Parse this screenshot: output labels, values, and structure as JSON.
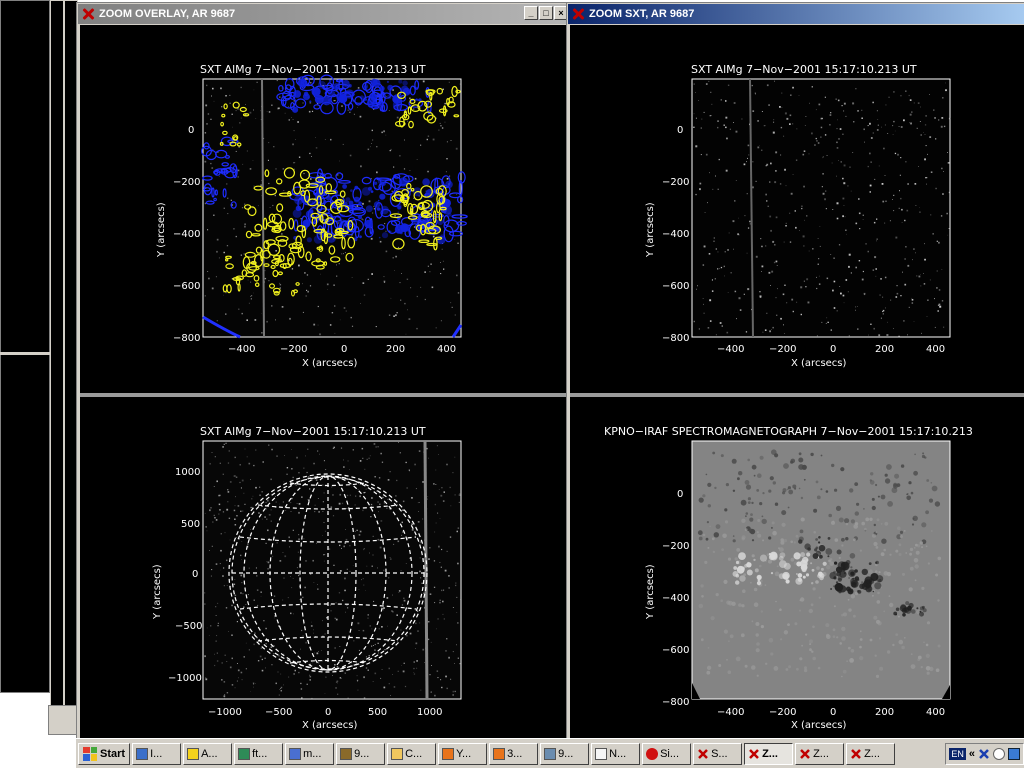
{
  "windows": {
    "overlay": {
      "title": "ZOOM OVERLAY, AR 9687"
    },
    "sxt": {
      "title": "ZOOM SXT, AR 9687"
    }
  },
  "plots": {
    "overlay": {
      "title": "SXT AlMg   7−Nov−2001  15:17:10.213  UT",
      "xlabel": "X (arcsecs)",
      "ylabel": "Y (arcsecs)",
      "xticks": [
        "−400",
        "−200",
        "0",
        "200",
        "400"
      ],
      "yticks": [
        "0",
        "−200",
        "−400",
        "−600",
        "−800"
      ]
    },
    "sxt": {
      "title": "SXT AlMg   7−Nov−2001  15:17:10.213  UT",
      "xlabel": "X (arcsecs)",
      "ylabel": "Y (arcsecs)",
      "xticks": [
        "−400",
        "−200",
        "0",
        "200",
        "400"
      ],
      "yticks": [
        "0",
        "−200",
        "−400",
        "−600",
        "−800"
      ]
    },
    "fulldisk": {
      "title": "SXT AlMg   7−Nov−2001  15:17:10.213  UT",
      "xlabel": "X (arcsecs)",
      "ylabel": "Y (arcsecs)",
      "xticks": [
        "−1000",
        "−500",
        "0",
        "500",
        "1000"
      ],
      "yticks": [
        "1000",
        "500",
        "0",
        "−500",
        "−1000"
      ]
    },
    "magnetogram": {
      "title": "KPNO−IRAF SPECTROMAGNETOGRAPH  7−Nov−2001  15:17:10.213",
      "xlabel": "X (arcsecs)",
      "ylabel": "Y (arcsecs)",
      "xticks": [
        "−400",
        "−200",
        "0",
        "200",
        "400"
      ],
      "yticks": [
        "0",
        "−200",
        "−400",
        "−600",
        "−800"
      ]
    }
  },
  "taskbar": {
    "start": "Start",
    "tasks": [
      {
        "label": "I...",
        "icon": "internet-icon"
      },
      {
        "label": "A...",
        "icon": "acrobat-icon"
      },
      {
        "label": "ft...",
        "icon": "ftp-icon"
      },
      {
        "label": "m...",
        "icon": "mail-icon"
      },
      {
        "label": "9...",
        "icon": "app-icon"
      },
      {
        "label": "C...",
        "icon": "folder-icon"
      },
      {
        "label": "Y...",
        "icon": "firefox-icon"
      },
      {
        "label": "3...",
        "icon": "firefox-icon"
      },
      {
        "label": "9...",
        "icon": "image-icon"
      },
      {
        "label": "N...",
        "icon": "notepad-icon"
      },
      {
        "label": "Si...",
        "icon": "record-icon"
      },
      {
        "label": "S...",
        "icon": "idl-window-icon"
      },
      {
        "label": "Z...",
        "icon": "idl-window-icon",
        "pressed": true
      },
      {
        "label": "Z...",
        "icon": "idl-window-icon"
      },
      {
        "label": "Z...",
        "icon": "idl-window-icon"
      }
    ],
    "tray": {
      "badge": "EN",
      "chevron": "«"
    }
  }
}
